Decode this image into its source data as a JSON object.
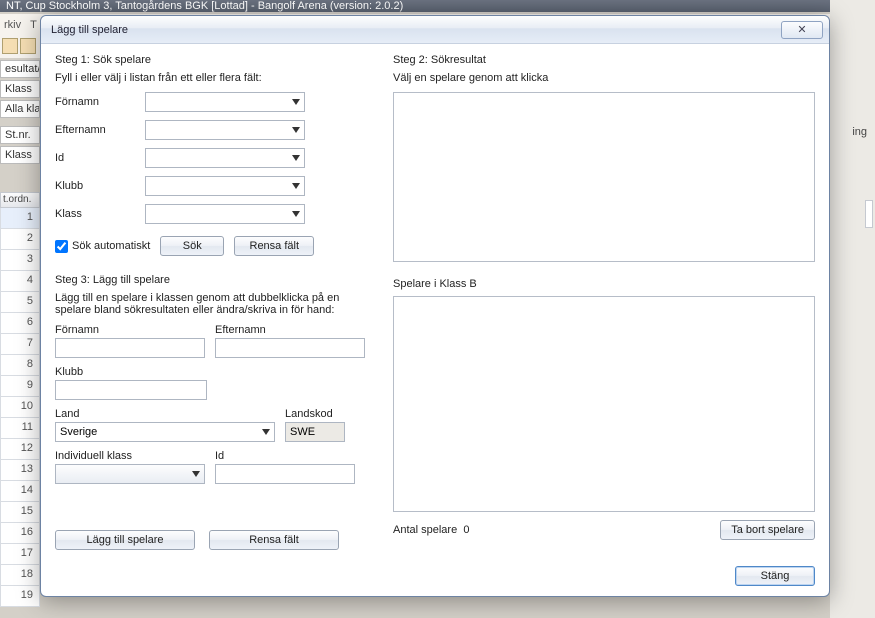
{
  "bg": {
    "title": "NT, Cup Stockholm 3, Tantogårdens BGK [Lottad] - Bangolf Arena (version: 2.0.2)",
    "menu": [
      "rkiv",
      "T"
    ],
    "leftTabs": [
      "esultat/S",
      "Klass",
      "Alla klass"
    ],
    "cols": [
      "St.nr.",
      "Klass"
    ],
    "gridHead": "t.ordn.",
    "rows": [
      "1",
      "2",
      "3",
      "4",
      "5",
      "6",
      "7",
      "8",
      "9",
      "10",
      "11",
      "12",
      "13",
      "14",
      "15",
      "16",
      "17",
      "18",
      "19"
    ],
    "rightCut": "ing"
  },
  "dialog": {
    "title": "Lägg till spelare",
    "step1": {
      "title": "Steg 1: Sök spelare",
      "hint": "Fyll i eller välj i listan från ett eller flera fält:",
      "fields": {
        "fornamn": "Förnamn",
        "efternamn": "Efternamn",
        "id": "Id",
        "klubb": "Klubb",
        "klass": "Klass"
      },
      "auto": "Sök automatiskt",
      "searchBtn": "Sök",
      "clearBtn": "Rensa fält"
    },
    "step2": {
      "title": "Steg 2: Sökresultat",
      "hint": "Välj en spelare genom att klicka"
    },
    "step3": {
      "title": "Steg 3: Lägg till spelare",
      "hint": "Lägg till en spelare i klassen genom att dubbelklicka på en spelare bland sökresultaten eller ändra/skriva in för hand:",
      "fornamn": "Förnamn",
      "efternamn": "Efternamn",
      "klubb": "Klubb",
      "land": "Land",
      "land_val": "Sverige",
      "landskod": "Landskod",
      "landskod_val": "SWE",
      "indiv": "Individuell klass",
      "id": "Id",
      "addBtn": "Lägg till spelare",
      "clearBtn": "Rensa fält"
    },
    "players": {
      "title": "Spelare i Klass B",
      "countLabel": "Antal spelare",
      "count": "0",
      "removeBtn": "Ta bort spelare"
    },
    "closeBtn": "Stäng"
  }
}
